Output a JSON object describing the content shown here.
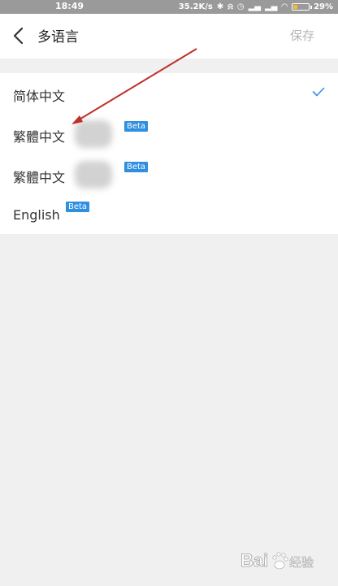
{
  "status_bar": {
    "time": "18:49",
    "network_speed": "35.2K/s",
    "icons": [
      "bluetooth-icon",
      "mute-icon",
      "alarm-icon",
      "signal-icon",
      "signal-icon",
      "wifi-icon"
    ],
    "battery_level": 0.29,
    "battery_text": "29%",
    "battery_color": "#f0c020"
  },
  "header": {
    "title": "多语言",
    "save_label": "保存",
    "back_icon": "chevron-left-icon"
  },
  "languages": [
    {
      "label": "简体中文",
      "selected": true,
      "beta": false
    },
    {
      "label": "繁體中文",
      "selected": false,
      "beta": true,
      "badge": "Beta"
    },
    {
      "label": "繁體中文",
      "selected": false,
      "beta": true,
      "badge": "Beta"
    },
    {
      "label": "English",
      "selected": false,
      "beta": true,
      "badge": "Beta"
    }
  ],
  "colors": {
    "accent": "#2f8fe0",
    "check": "#3a8ee6",
    "annotation_arrow": "#c0302a",
    "background": "#f0f0f0"
  },
  "watermark": {
    "logo_icon": "baidu-paw-icon",
    "text": "Bai 经验"
  }
}
